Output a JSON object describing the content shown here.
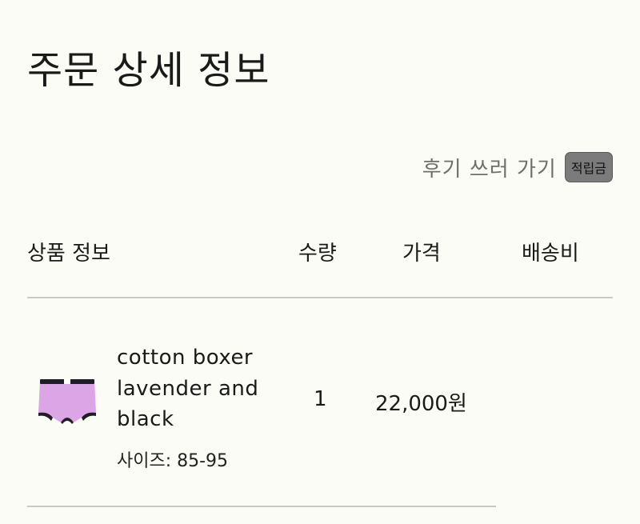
{
  "header": {
    "title": "주문 상세 정보"
  },
  "review": {
    "link_label": "후기 쓰러 가기",
    "badge_label": "적립금"
  },
  "table": {
    "columns": {
      "product": "상품 정보",
      "quantity": "수량",
      "price": "가격",
      "shipping": "배송비"
    },
    "items": [
      {
        "name": "cotton boxer lavender and black",
        "option": "사이즈: 85-95",
        "quantity": "1",
        "price": "22,000원",
        "shipping": ""
      }
    ]
  },
  "colors": {
    "background": "#fcfcf6",
    "badge": "#7b7b7b",
    "product_lavender": "#dca6e6",
    "product_trim": "#1e1e24"
  }
}
